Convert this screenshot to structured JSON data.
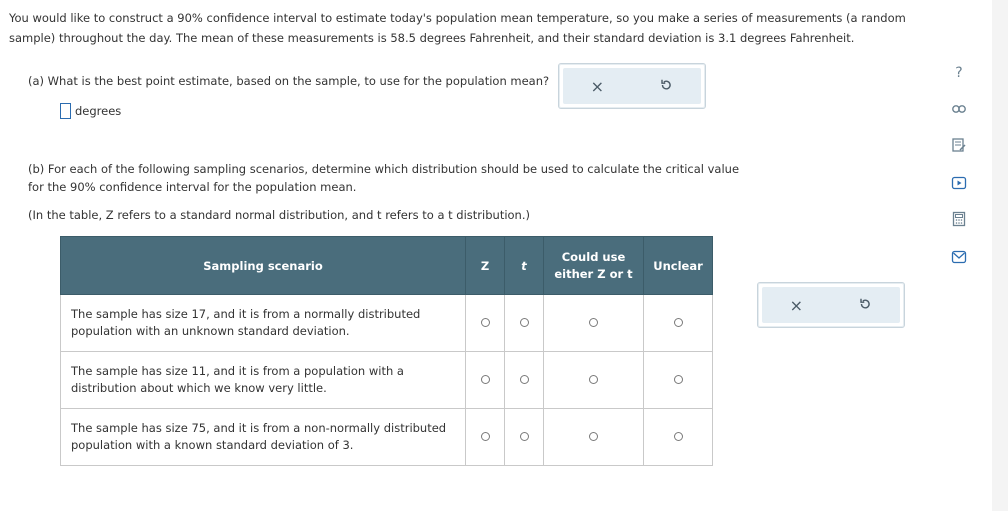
{
  "intro": {
    "line1": "You would like to construct a 90% confidence interval to estimate today's population mean temperature, so you make a series of measurements (a random",
    "line2": "sample) throughout the day. The mean of these measurements is 58.5 degrees Fahrenheit, and their standard deviation is 3.1 degrees Fahrenheit."
  },
  "part_a": {
    "question": "(a) What is the best point estimate, based on the sample, to use for the population mean?",
    "unit": "degrees",
    "value": ""
  },
  "part_b": {
    "line1": "(b) For each of the following sampling scenarios, determine which distribution should be used to calculate the critical value",
    "line2": "for the 90% confidence interval for the population mean.",
    "note": "(In the table, Z refers to a standard normal distribution, and t refers to a t distribution.)"
  },
  "table": {
    "headers": {
      "scenario": "Sampling scenario",
      "z": "Z",
      "t": "t",
      "either_1": "Could use",
      "either_2": "either Z or t",
      "unclear": "Unclear"
    },
    "rows": [
      {
        "line1": "The sample has size 17, and it is from a normally distributed",
        "line2": "population with an unknown standard deviation."
      },
      {
        "line1": "The sample has size 11, and it is from a population with a",
        "line2": "distribution about which we know very little."
      },
      {
        "line1": "The sample has size 75, and it is from a non-normally distributed",
        "line2": "population with a known standard deviation of 3."
      }
    ]
  },
  "buttons": {
    "clear_symbol": "×"
  },
  "sidebar": {
    "icons": [
      "help-icon",
      "link-icon",
      "worksheet-icon",
      "video-icon",
      "calculator-icon",
      "mail-icon"
    ],
    "help_symbol": "?"
  },
  "colors": {
    "header_bg": "#4a6d7c",
    "button_bg": "#e4edf3",
    "accent": "#2b6cb0"
  }
}
